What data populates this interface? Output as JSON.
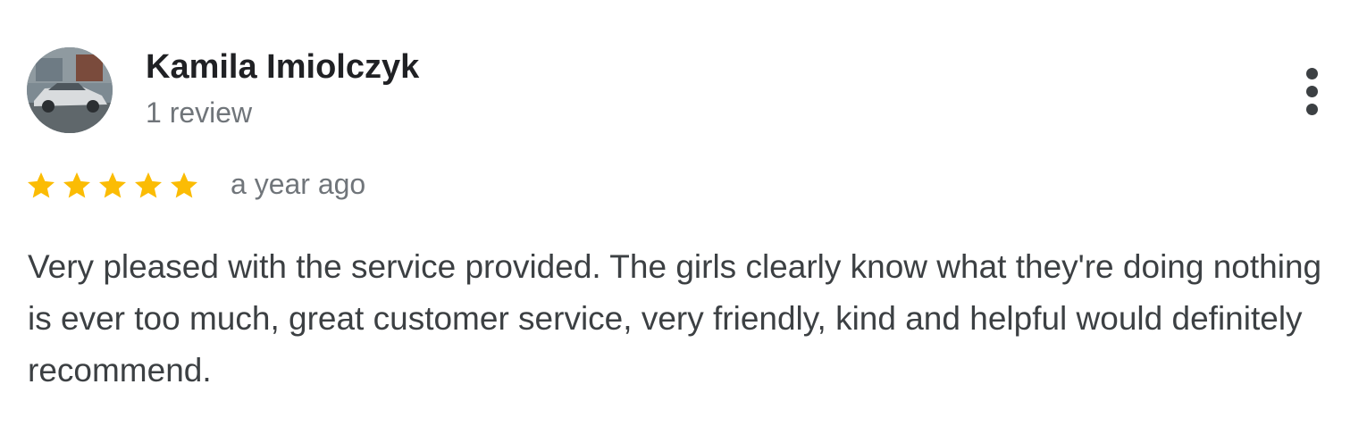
{
  "review": {
    "author_name": "Kamila Imiolczyk",
    "review_count": "1 review",
    "rating": 5,
    "rating_max": 5,
    "date": "a year ago",
    "text": "Very pleased with the service provided. The girls clearly know what they're doing nothing is ever too much, great customer service, very friendly, kind and helpful would definitely recommend."
  },
  "icons": {
    "avatar": "avatar-photo-car",
    "star": "star-icon",
    "more": "more-vertical-icon"
  },
  "colors": {
    "star_fill": "#fbbc04",
    "name": "#202124",
    "secondary_text": "#70757a",
    "body_text": "#3c4043"
  }
}
